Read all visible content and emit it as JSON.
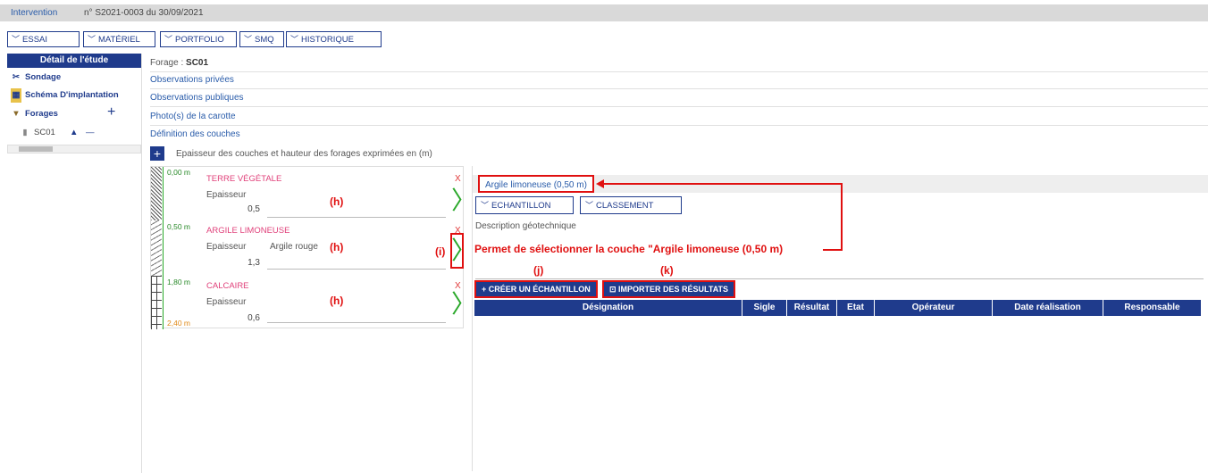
{
  "header": {
    "tab": "Intervention",
    "ref": "n° S2021-0003 du 30/09/2021"
  },
  "menu": [
    "ESSAI",
    "MATÉRIEL",
    "PORTFOLIO",
    "SMQ",
    "HISTORIQUE"
  ],
  "left": {
    "title": "Détail de l'étude",
    "items": [
      "Sondage",
      "Schéma D'implantation",
      "Forages"
    ],
    "add": "+",
    "sub_item": "SC01",
    "sub_minus": "—"
  },
  "main": {
    "forage_label": "Forage :",
    "forage_value": "SC01",
    "sections": [
      "Observations privées",
      "Observations publiques",
      "Photo(s) de la carotte",
      "Définition des couches"
    ],
    "add_layer": "+",
    "layers_caption": "Epaisseur des couches et hauteur des forages exprimées en (m)"
  },
  "layers": [
    {
      "name": "TERRE VÉGÉTALE",
      "depth": "0,00 m",
      "thickness_label": "Epaisseur",
      "thickness": "0,5",
      "description": "",
      "annotation": "(h)"
    },
    {
      "name": "ARGILE LIMONEUSE",
      "depth": "0,50 m",
      "thickness_label": "Epaisseur",
      "thickness": "1,3",
      "description": "Argile rouge",
      "annotation": "(h)"
    },
    {
      "name": "CALCAIRE",
      "depth": "1,80 m",
      "thickness_label": "Epaisseur",
      "thickness": "0,6",
      "description": "",
      "annotation": "(h)"
    }
  ],
  "bottom_depth": "2,40 m",
  "delete_symbol": "X",
  "select_symbol": "〉",
  "right": {
    "selected_tab": "Argile limoneuse (0,50 m)",
    "buttons": [
      "ECHANTILLON",
      "CLASSEMENT"
    ],
    "desc_label": "Description géotechnique",
    "create_btn": "CRÉER UN ÉCHANTILLON",
    "import_btn": "IMPORTER DES RÉSULTATS",
    "columns": [
      "Désignation",
      "Sigle",
      "Résultat",
      "Etat",
      "Opérateur",
      "Date réalisation",
      "Responsable validation"
    ]
  },
  "annotations": {
    "i": "(i)",
    "j": "(j)",
    "k": "(k)",
    "note": "Permet de sélectionner la couche \"Argile limoneuse (0,50 m)"
  },
  "colors": {
    "primary": "#1f3b8c",
    "annotation": "#e01010",
    "layer_name": "#e0407a",
    "select_chevron": "#2aa82a"
  }
}
